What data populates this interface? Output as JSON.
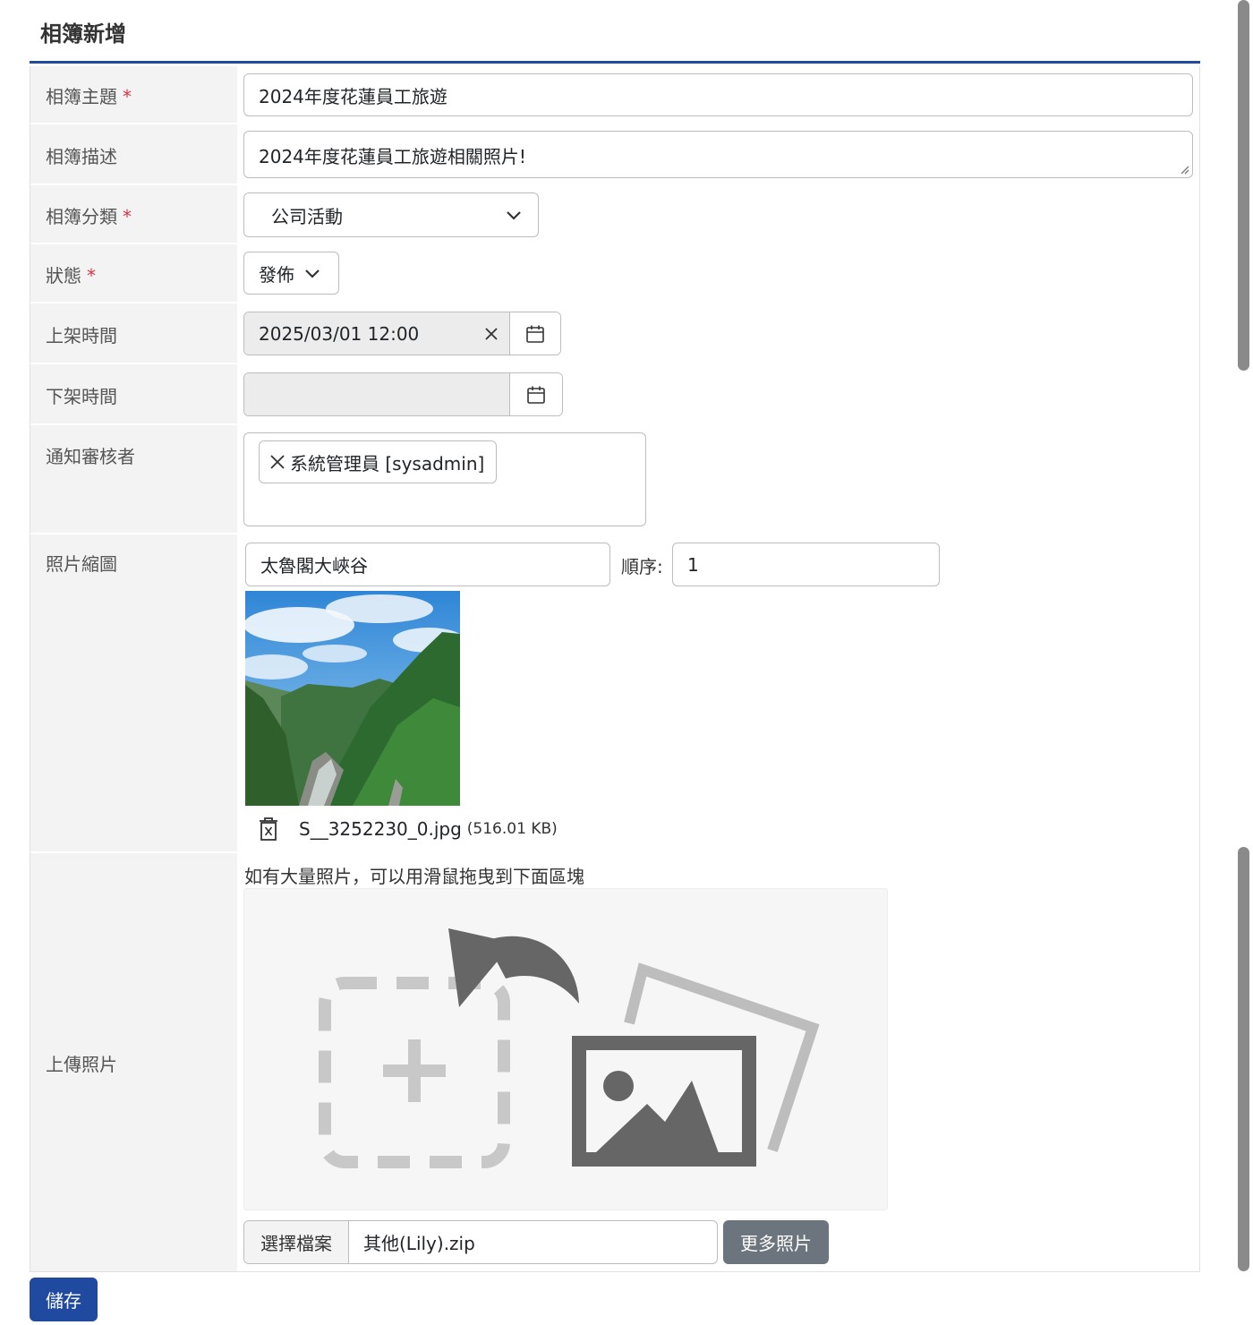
{
  "page": {
    "title": "相簿新增"
  },
  "form": {
    "subject": {
      "label": "相簿主題",
      "value": "2024年度花蓮員工旅遊"
    },
    "description": {
      "label": "相簿描述",
      "value": "2024年度花蓮員工旅遊相關照片!"
    },
    "category": {
      "label": "相簿分類",
      "value": "公司活動"
    },
    "status": {
      "label": "狀態",
      "value": "發佈"
    },
    "publish_time": {
      "label": "上架時間",
      "value": "2025/03/01 12:00"
    },
    "unpublish_time": {
      "label": "下架時間",
      "value": ""
    },
    "reviewers": {
      "label": "通知審核者",
      "tags": [
        "系統管理員 [sysadmin]"
      ]
    },
    "thumbnail": {
      "label": "照片縮圖",
      "caption": "太魯閣大峽谷",
      "order_label": "順序:",
      "order_value": "1",
      "file_name": "S__3252230_0.jpg",
      "file_size": "(516.01 KB)"
    },
    "upload": {
      "label": "上傳照片",
      "hint": "如有大量照片，可以用滑鼠拖曳到下面區塊",
      "choose_label": "選擇檔案",
      "chosen_file": "其他(Lily).zip",
      "more_label": "更多照片"
    },
    "required_mark": "*"
  },
  "actions": {
    "save_label": "儲存"
  },
  "icons": {
    "select": "chevron-down-icon",
    "clear": "close-icon",
    "calendar": "calendar-icon",
    "tag_remove": "close-icon",
    "delete_file": "trash-icon",
    "dropzone": "drag-drop-upload-icon"
  }
}
